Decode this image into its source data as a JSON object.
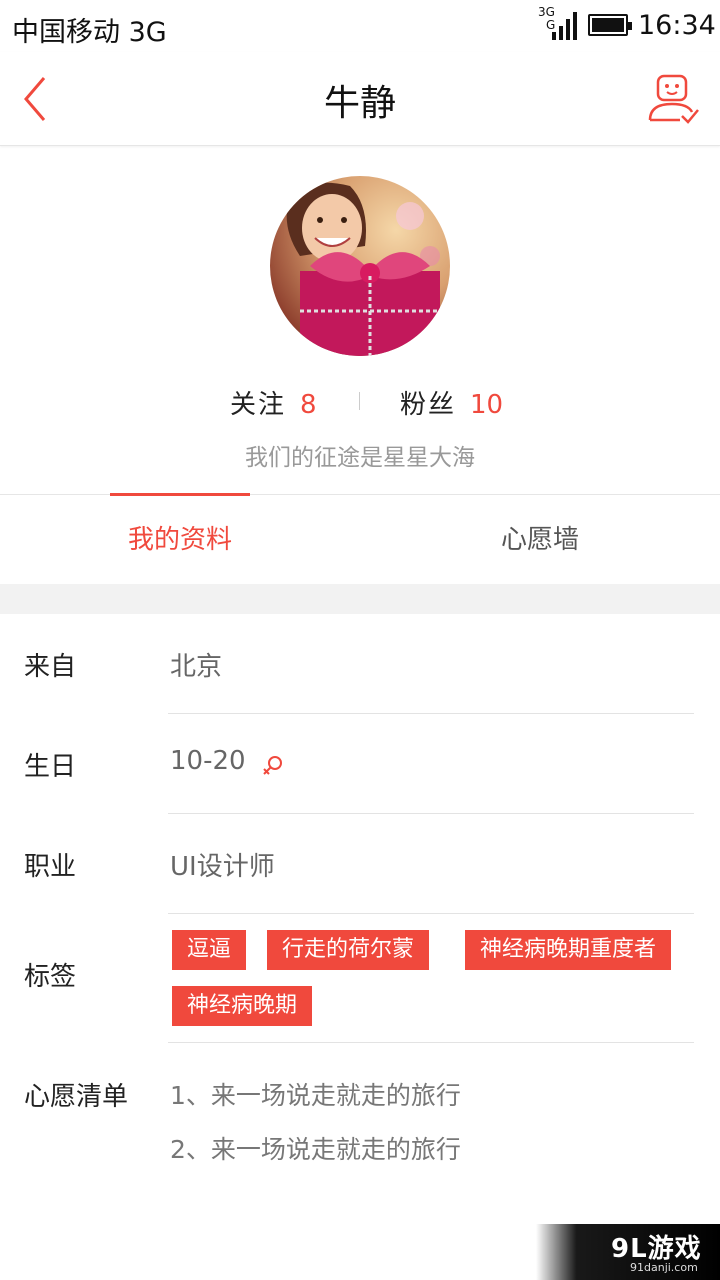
{
  "status_bar": {
    "carrier": "中国移动 3G",
    "network_small": "3G",
    "network_small2": "G",
    "time": "16:34"
  },
  "nav": {
    "title": "牛静",
    "back_icon": "chevron-left-icon",
    "profile_icon": "user-check-icon"
  },
  "profile": {
    "follow_label": "关注",
    "follow_count": "8",
    "fans_label": "粉丝",
    "fans_count": "10",
    "motto": "我们的征途是星星大海"
  },
  "tabs": [
    {
      "label": "我的资料",
      "active": true
    },
    {
      "label": "心愿墙",
      "active": false
    }
  ],
  "info": {
    "from_label": "来自",
    "from_value": "北京",
    "birthday_label": "生日",
    "birthday_value": "10-20",
    "gender_icon": "female-icon",
    "job_label": "职业",
    "job_value": "UI设计师",
    "tags_label": "标签",
    "tags": [
      "逗逼",
      "行走的荷尔蒙",
      "神经病晚期重度者",
      "神经病晚期"
    ],
    "wishlist_label": "心愿清单",
    "wishlist": [
      "1、来一场说走就走的旅行",
      "2、来一场说走就走的旅行"
    ]
  },
  "watermark": {
    "logo": "9L游戏",
    "site": "91danji.com"
  },
  "colors": {
    "accent": "#f0493d",
    "text": "#222222",
    "muted": "#999999"
  }
}
